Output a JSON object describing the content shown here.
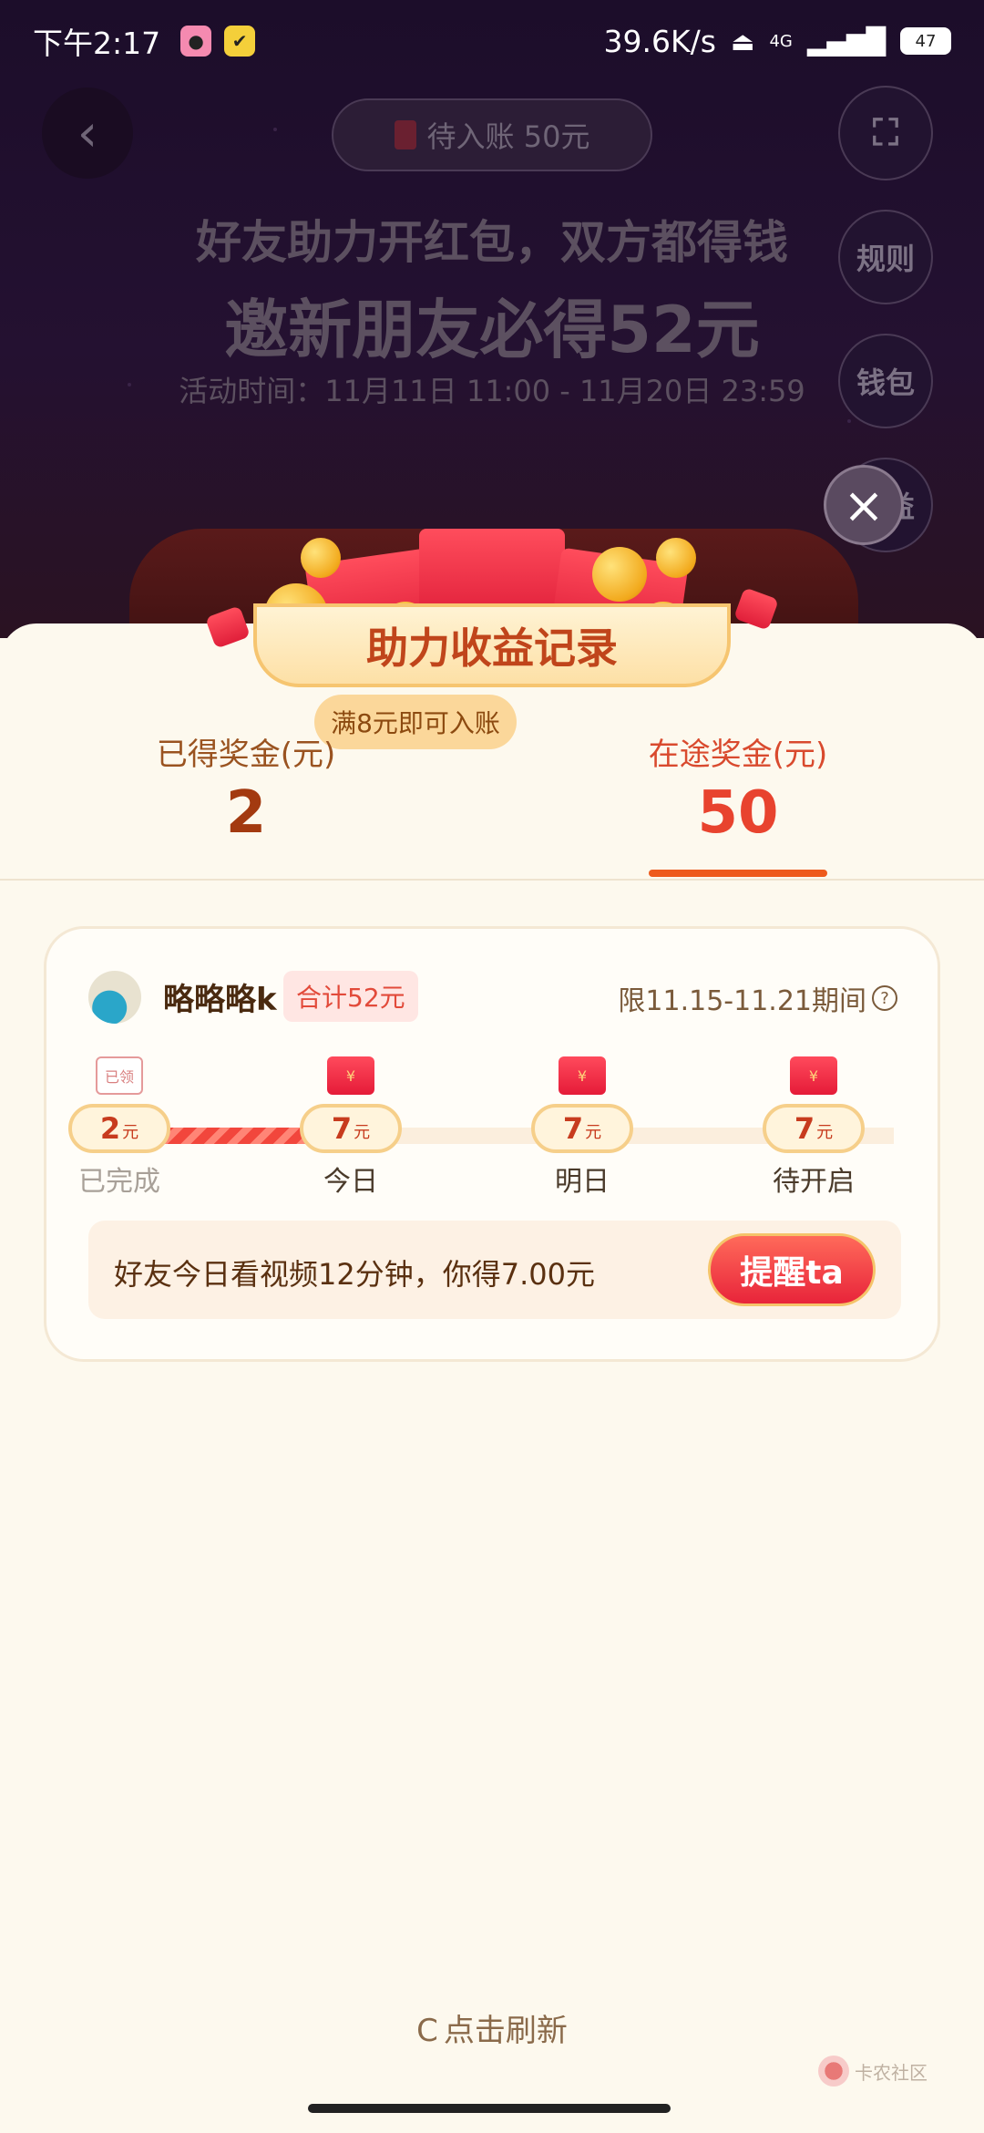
{
  "status_bar": {
    "time": "下午2:17",
    "network_speed": "39.6K/s",
    "signal_label": "4G",
    "battery": "47"
  },
  "background": {
    "pending_pill": "待入账 50元",
    "side_buttons": [
      "规则",
      "钱包",
      "收益"
    ],
    "title1": "好友助力开红包，双方都得钱",
    "title2": "邀新朋友必得52元",
    "activity_time": "活动时间：11月11日 11:00 - 11月20日 23:59"
  },
  "sheet": {
    "title": "助力收益记录",
    "tip": "满8元即可入账",
    "earned": {
      "label": "已得奖金(元)",
      "value": "2"
    },
    "in_transit": {
      "label": "在途奖金(元)",
      "value": "50"
    }
  },
  "friend_card": {
    "name": "略略略k",
    "total": "合计52元",
    "period": "限11.15-11.21期间",
    "steps": [
      {
        "tag": "已领",
        "amount": "2",
        "unit": "元",
        "caption": "已完成"
      },
      {
        "tag": "¥",
        "amount": "7",
        "unit": "元",
        "caption": "今日"
      },
      {
        "tag": "¥",
        "amount": "7",
        "unit": "元",
        "caption": "明日"
      },
      {
        "tag": "¥",
        "amount": "7",
        "unit": "元",
        "caption": "待开启"
      }
    ],
    "message": "好友今日看视频12分钟，你得7.00元",
    "remind_button": "提醒ta"
  },
  "refresh_label": "点击刷新",
  "watermark": "卡农社区",
  "colors": {
    "accent_red": "#e8432e",
    "brown_text": "#9a5320",
    "sheet_bg": "#fdf9ee"
  }
}
